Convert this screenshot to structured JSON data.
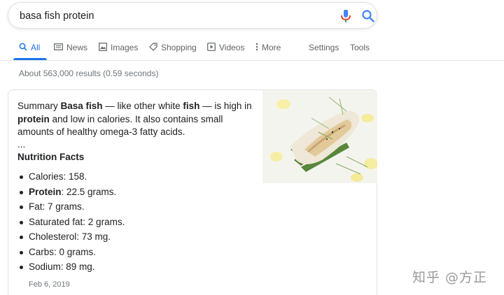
{
  "search": {
    "query": "basa fish protein"
  },
  "tabs": [
    {
      "label": "All",
      "icon": "search-icon",
      "active": true
    },
    {
      "label": "News",
      "icon": "news-icon"
    },
    {
      "label": "Images",
      "icon": "image-icon"
    },
    {
      "label": "Shopping",
      "icon": "tag-icon"
    },
    {
      "label": "Videos",
      "icon": "video-icon"
    },
    {
      "label": "More",
      "icon": "more-vertical-icon"
    },
    {
      "label": "Settings"
    },
    {
      "label": "Tools"
    }
  ],
  "result_stats": "About 563,000 results (0.59 seconds)",
  "snippet": {
    "summary_parts": [
      "Summary ",
      "Basa fish",
      " — like other white ",
      "fish",
      " — is high in ",
      "protein",
      " and low in calories. It also contains small amounts of healthy omega-3 fatty acids."
    ],
    "ellipsis": "...",
    "heading": "Nutrition Facts",
    "facts": [
      {
        "bold": "",
        "text": "Calories: 158."
      },
      {
        "bold": "Protein",
        "text": ": 22.5 grams."
      },
      {
        "bold": "",
        "text": "Fat: 7 grams."
      },
      {
        "bold": "",
        "text": "Saturated fat: 2 grams."
      },
      {
        "bold": "",
        "text": "Cholesterol: 73 mg."
      },
      {
        "bold": "",
        "text": "Carbs: 0 grams."
      },
      {
        "bold": "",
        "text": "Sodium: 89 mg."
      }
    ],
    "date": "Feb 6, 2019"
  },
  "watermark": "知乎 @方正",
  "colors": {
    "accent": "#1a73e8",
    "text": "#202124",
    "secondary": "#5f6368",
    "mic_red": "#ea4335"
  }
}
